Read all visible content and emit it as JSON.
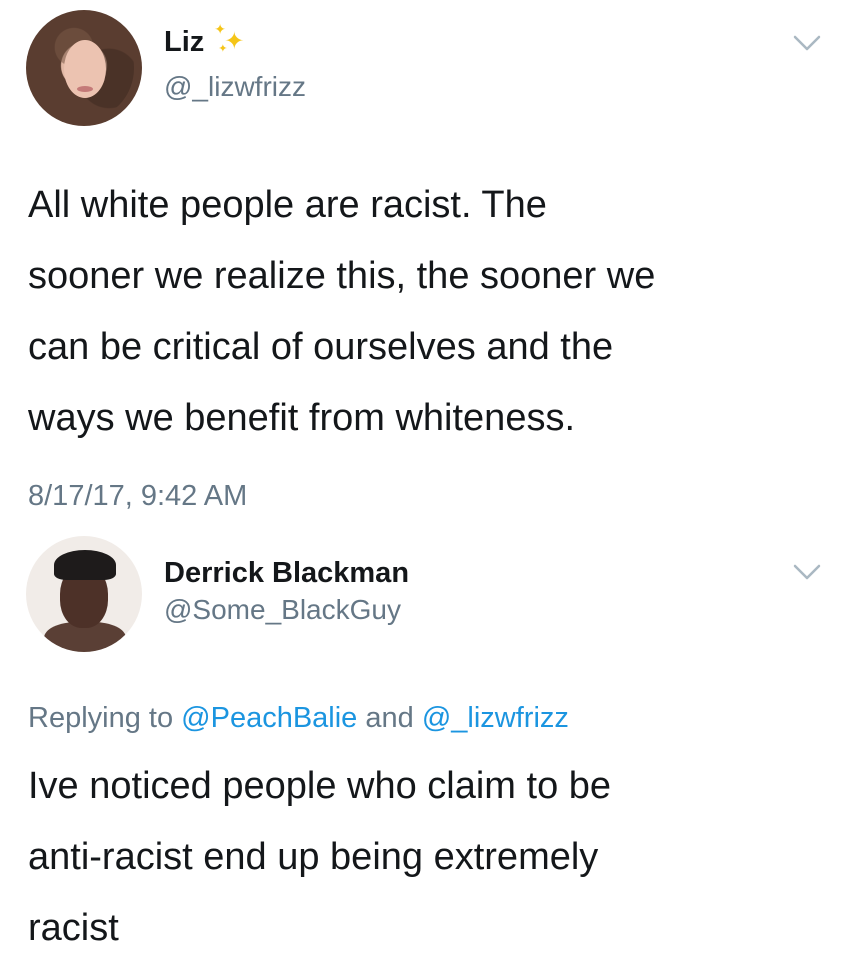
{
  "tweets": [
    {
      "display_name": "Liz",
      "handle": "@_lizwfrizz",
      "text": "All white people are racist.  The\nsooner we realize this, the sooner we\ncan be critical of ourselves and the\nways we benefit from whiteness.",
      "timestamp": "8/17/17, 9:42 AM",
      "badge_icon": "sparkle-icon"
    },
    {
      "display_name": "Derrick Blackman",
      "handle": "@Some_BlackGuy",
      "reply_prefix": "Replying to",
      "reply_mention_1": "@PeachBalie",
      "reply_and": "and",
      "reply_mention_2": "@_lizwfrizz",
      "text": "Ive noticed people who claim to be\nanti-racist end up being extremely\nracist"
    }
  ],
  "colors": {
    "text": "#14171a",
    "secondary": "#657786",
    "link": "#1b95e0",
    "chevron": "#aab8c2"
  }
}
